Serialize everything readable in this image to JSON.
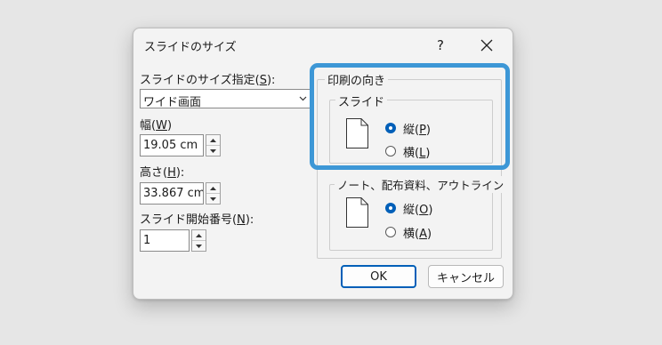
{
  "dialog": {
    "title": "スライドのサイズ",
    "help_label": "?"
  },
  "size": {
    "label_prefix": "スライドのサイズ指定(",
    "label_key": "S",
    "label_suffix": "):",
    "selected": "ワイド画面"
  },
  "width": {
    "label_prefix": "幅(",
    "label_key": "W",
    "label_suffix": ")",
    "value": "19.05 cm"
  },
  "height": {
    "label_prefix": "高さ(",
    "label_key": "H",
    "label_suffix": "):",
    "value": "33.867 cm"
  },
  "start_number": {
    "label_prefix": "スライド開始番号(",
    "label_key": "N",
    "label_suffix": "):",
    "value": "1"
  },
  "orientation": {
    "group_title": "印刷の向き",
    "slides": {
      "title": "スライド",
      "portrait": {
        "prefix": "縦(",
        "key": "P",
        "suffix": ")",
        "selected": true
      },
      "landscape": {
        "prefix": "横(",
        "key": "L",
        "suffix": ")",
        "selected": false
      }
    },
    "notes": {
      "title": "ノート、配布資料、アウトライン",
      "portrait": {
        "prefix": "縦(",
        "key": "O",
        "suffix": ")",
        "selected": true
      },
      "landscape": {
        "prefix": "横(",
        "key": "A",
        "suffix": ")",
        "selected": false
      }
    }
  },
  "buttons": {
    "ok": "OK",
    "cancel": "キャンセル"
  },
  "colors": {
    "accent": "#005fb8",
    "highlight": "#3d97d6"
  }
}
